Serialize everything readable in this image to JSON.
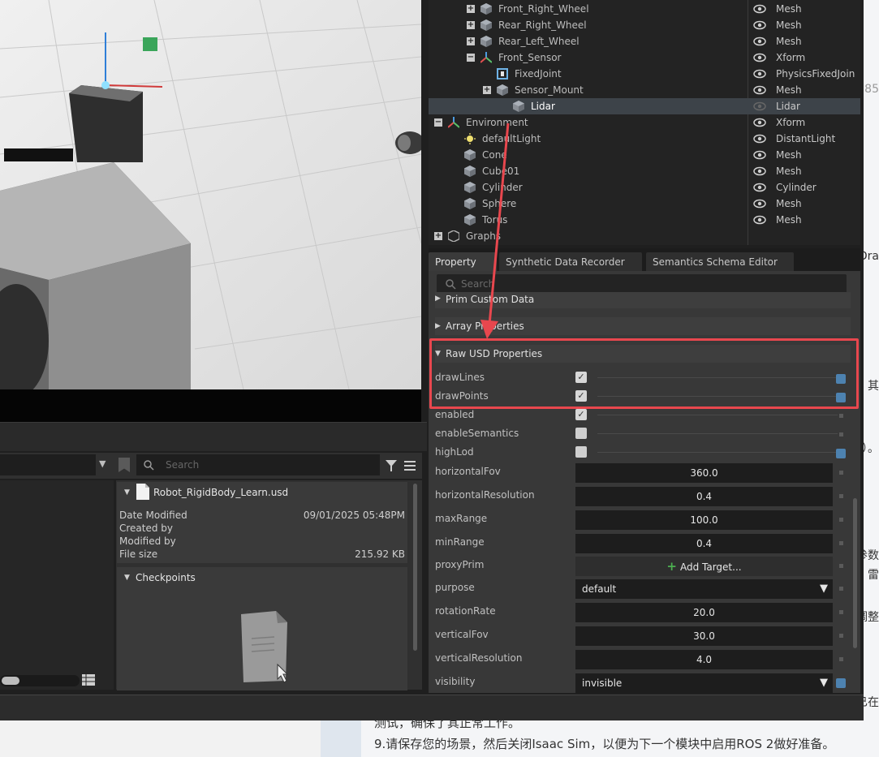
{
  "background_page": {
    "lines": [
      "测试，确保了其正常工作。",
      "9.请保存您的场景，然后关闭Isaac Sim，以便为下一个模块中启用ROS 2做好准备。"
    ],
    "edge_fragments": [
      "Dra",
      "其",
      "）。",
      "参数",
      "雷",
      "调整",
      "已在",
      "85"
    ]
  },
  "stage": {
    "rows": [
      {
        "label": "Front_Right_Wheel",
        "type": "Mesh",
        "icon": "cube-icon",
        "expander": "+"
      },
      {
        "label": "Rear_Right_Wheel",
        "type": "Mesh",
        "icon": "cube-icon",
        "expander": "+"
      },
      {
        "label": "Rear_Left_Wheel",
        "type": "Mesh",
        "icon": "cube-icon",
        "expander": "+"
      },
      {
        "label": "Front_Sensor",
        "type": "Xform",
        "icon": "xform-icon",
        "expander": "−"
      },
      {
        "label": "FixedJoint",
        "type": "PhysicsFixedJoin",
        "icon": "joint-icon",
        "expander": ""
      },
      {
        "label": "Sensor_Mount",
        "type": "Mesh",
        "icon": "cube-icon",
        "expander": "+"
      },
      {
        "label": "Lidar",
        "type": "Lidar",
        "icon": "cube-icon",
        "expander": "",
        "selected": true
      },
      {
        "label": "Environment",
        "type": "Xform",
        "icon": "xform-icon",
        "expander": "−"
      },
      {
        "label": "defaultLight",
        "type": "DistantLight",
        "icon": "light-icon",
        "expander": ""
      },
      {
        "label": "Cone",
        "type": "Mesh",
        "icon": "cube-icon",
        "expander": ""
      },
      {
        "label": "Cube01",
        "type": "Mesh",
        "icon": "cube-icon",
        "expander": ""
      },
      {
        "label": "Cylinder",
        "type": "Cylinder",
        "icon": "cube-icon",
        "expander": ""
      },
      {
        "label": "Sphere",
        "type": "Mesh",
        "icon": "cube-icon",
        "expander": ""
      },
      {
        "label": "Torus",
        "type": "Mesh",
        "icon": "cube-icon",
        "expander": ""
      },
      {
        "label": "Graphs",
        "type": "",
        "icon": "graph-icon",
        "expander": "+"
      }
    ]
  },
  "tabs": [
    {
      "label": "Property",
      "active": true
    },
    {
      "label": "Synthetic Data Recorder",
      "active": false
    },
    {
      "label": "Semantics Schema Editor",
      "active": false
    }
  ],
  "property": {
    "search_placeholder": "Search",
    "sections": {
      "prim_custom_data": "Prim Custom Data",
      "array_properties": "Array Properties",
      "raw_usd_properties": "Raw USD Properties"
    },
    "rows": {
      "drawLines": {
        "label": "drawLines",
        "checked": true
      },
      "drawPoints": {
        "label": "drawPoints",
        "checked": true
      },
      "enabled": {
        "label": "enabled",
        "checked": true
      },
      "enableSemantics": {
        "label": "enableSemantics",
        "checked": false
      },
      "highLod": {
        "label": "highLod",
        "checked": false
      },
      "horizontalFov": {
        "label": "horizontalFov",
        "value": "360.0"
      },
      "horizontalResolution": {
        "label": "horizontalResolution",
        "value": "0.4"
      },
      "maxRange": {
        "label": "maxRange",
        "value": "100.0"
      },
      "minRange": {
        "label": "minRange",
        "value": "0.4"
      },
      "proxyPrim": {
        "label": "proxyPrim",
        "value": "Add Target..."
      },
      "purpose": {
        "label": "purpose",
        "value": "default"
      },
      "rotationRate": {
        "label": "rotationRate",
        "value": "20.0"
      },
      "verticalFov": {
        "label": "verticalFov",
        "value": "30.0"
      },
      "verticalResolution": {
        "label": "verticalResolution",
        "value": "4.0"
      },
      "visibility": {
        "label": "visibility",
        "value": "invisible"
      }
    }
  },
  "content_browser": {
    "search_placeholder": "Search",
    "file": {
      "name": "Robot_RigidBody_Learn.usd",
      "date_modified_label": "Date Modified",
      "date_modified": "09/01/2025 05:48PM",
      "created_by_label": "Created by",
      "modified_by_label": "Modified by",
      "file_size_label": "File size",
      "file_size": "215.92 KB"
    },
    "checkpoints_title": "Checkpoints"
  },
  "colors": {
    "highlight_box": "#e8474e",
    "accent": "#4d82b0"
  }
}
